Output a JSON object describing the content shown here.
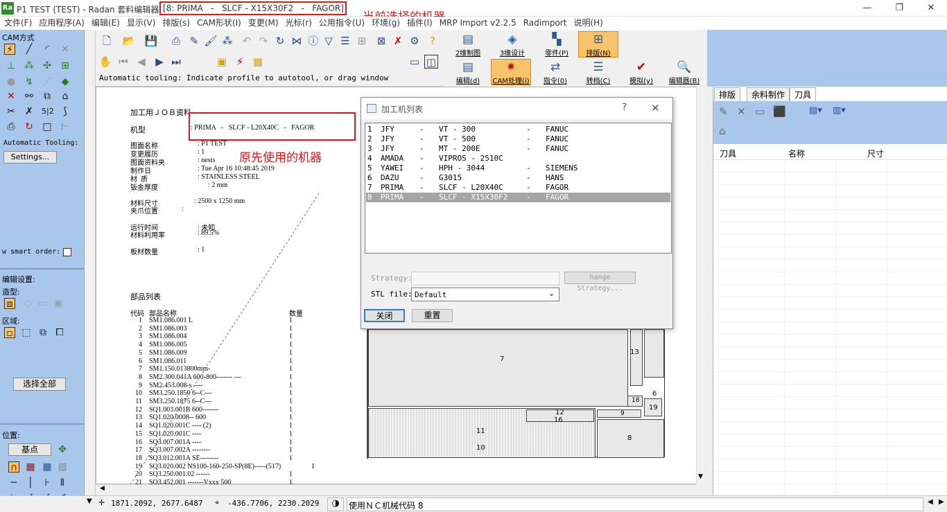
{
  "window": {
    "logo": "Ra",
    "title_prefix": "P1 TEST (TEST) - Radan 套料编辑器",
    "title_machine": "[8: PRIMA   -   SLCF - X15X30F2   -   FAGOR]",
    "annotation_current": "当前选择的机器",
    "annotation_original": "原先使用的机器",
    "controls": [
      "—",
      "❐",
      "✕"
    ]
  },
  "menu": [
    "文件(F)",
    "应用程序(A)",
    "编辑(E)",
    "显示(V)",
    "排版(s)",
    "CAM形状(I)",
    "变更(M)",
    "光标(r)",
    "公用指令(U)",
    "环境(g)",
    "插件(l)",
    "MRP Import v2.2.5",
    "Radimport",
    "说明(H)"
  ],
  "left_panel": {
    "cam_title": "CAM方式",
    "auto_tooling_label": "Automatic Tooling:",
    "settings_button": "Settings...",
    "smart_order_label": "w smart order:",
    "edit_settings": "编辑设置:",
    "shape_label": "造型:",
    "region_label": "区域:",
    "select_all": "选择全部",
    "position_label": "位置:",
    "base_point": "基点"
  },
  "big_buttons": [
    {
      "label": "2维制图",
      "icon": "drawing-2d-icon"
    },
    {
      "label": "3维设计",
      "icon": "design-3d-icon"
    },
    {
      "label": "零件(P)",
      "icon": "part-icon"
    },
    {
      "label": "排版(N)",
      "icon": "nest-icon",
      "active": true
    },
    {
      "label": "编辑(d)",
      "icon": "edit-icon"
    },
    {
      "label": "CAM处理(i)",
      "icon": "cam-icon",
      "active": true
    },
    {
      "label": "指令(0)",
      "icon": "command-icon"
    },
    {
      "label": "转档(C)",
      "icon": "convert-icon"
    },
    {
      "label": "模拟(y)",
      "icon": "simulate-icon"
    },
    {
      "label": "编辑器(B)",
      "icon": "editor-icon"
    }
  ],
  "auto_tooling_text": "Automatic tooling: Indicate profile to autotool, or drag window",
  "job": {
    "heading": "加工用ＪＯＢ资料",
    "machine_label": "机型",
    "machine_value": ": PRIMA   -   SLCF - L20X40C   -   FAGOR",
    "drawing_name_label": "图面名称",
    "drawing_name_value": ": P1 TEST",
    "revision_label": "变更履历",
    "revision_value": ": 1",
    "folder_label": "图面资料夹",
    "folder_value": ": nests",
    "date_label": "制作日",
    "date_value": ": Tue Apr 16 10:48:45 2019",
    "material_label": "材  质",
    "material_value": ": STAINLESS STEEL",
    "thickness_label": "钣金厚度",
    "thickness_value": ": 2 mm",
    "sheet_size_label": "材料尺寸",
    "sheet_size_value": ": 2500 x 1250 mm",
    "clamp_label": "夹爪位置",
    "clamp_value": ":",
    "run_time_label": "运行时间",
    "run_time_value": ": 未知",
    "utilization_label": "材料利用率",
    "utilization_value": ": 89.5%",
    "sheets_label": "板材数量",
    "sheets_value": ": 1",
    "parts_heading": "部品列表",
    "col_code": "代码",
    "col_name": "部品名称",
    "col_qty": "数量",
    "parts": [
      {
        "no": "1",
        "name": "SM1.086.001 L",
        "qty": "1"
      },
      {
        "no": "2",
        "name": "SM1.086.003",
        "qty": "1"
      },
      {
        "no": "3",
        "name": "SM1.086.004",
        "qty": "1"
      },
      {
        "no": "4",
        "name": "SM1.086.005",
        "qty": "1"
      },
      {
        "no": "5",
        "name": "SM1.086.009",
        "qty": "1"
      },
      {
        "no": "6",
        "name": "SM1.086.011",
        "qty": "1"
      },
      {
        "no": "7",
        "name": "SM1.150.013800mm-",
        "qty": "1"
      },
      {
        "no": "8",
        "name": "SM2.300.041A 600-800------- ---",
        "qty": "1"
      },
      {
        "no": "9",
        "name": "SM2.453.008-s ----",
        "qty": "1"
      },
      {
        "no": "10",
        "name": "SM3.250.1850 6--C---",
        "qty": "1"
      },
      {
        "no": "11",
        "name": "SM3.250.1875 6--C---",
        "qty": "1"
      },
      {
        "no": "12",
        "name": "SQ1.003.001B 600-------",
        "qty": "1"
      },
      {
        "no": "13",
        "name": "SQ1.020.0008-- 600",
        "qty": "1"
      },
      {
        "no": "14",
        "name": "SQ1.020.001C ---- (2)",
        "qty": "1"
      },
      {
        "no": "15",
        "name": "SQ1.020.001C ----",
        "qty": "1"
      },
      {
        "no": "16",
        "name": "SQ3.007.001A ----",
        "qty": "1"
      },
      {
        "no": "17",
        "name": "SQ3.007.002A --------",
        "qty": "1"
      },
      {
        "no": "18",
        "name": "SQ3.012.001A SE--------",
        "qty": "1"
      },
      {
        "no": "19",
        "name": "SQ3.020.002 NS100-160-250-SP(8E)-----(517)",
        "qty": "1"
      },
      {
        "no": "20",
        "name": "SQ3.250.001.02 ------",
        "qty": "1"
      },
      {
        "no": "21",
        "name": "SQ3.452.001 -------Vxxx 500",
        "qty": "1"
      }
    ]
  },
  "sheet_labels": [
    "13",
    "7",
    "6",
    "18",
    "19",
    "12",
    "16",
    "9",
    "11",
    "10",
    "8"
  ],
  "dialog": {
    "title": "加工机列表",
    "help": "?",
    "close": "✕",
    "machines": [
      {
        "no": "1",
        "maker": "JFY",
        "model": "VT - 300",
        "control": "FANUC"
      },
      {
        "no": "2",
        "maker": "JFY",
        "model": "VT - 500",
        "control": "FANUC"
      },
      {
        "no": "3",
        "maker": "JFY",
        "model": "MT - 200E",
        "control": "FANUC"
      },
      {
        "no": "4",
        "maker": "AMADA",
        "model": "VIPROS - 2510C",
        "control": ""
      },
      {
        "no": "5",
        "maker": "YAWEI",
        "model": "HPH - 3044",
        "control": "SIEMENS"
      },
      {
        "no": "6",
        "maker": "DAZU",
        "model": "G3015",
        "control": "HANS"
      },
      {
        "no": "7",
        "maker": "PRIMA",
        "model": "SLCF - L20X40C",
        "control": "FAGOR"
      },
      {
        "no": "8",
        "maker": "PRIMA",
        "model": "SLCF - X15X30F2",
        "control": "FAGOR",
        "selected": true
      }
    ],
    "strategy_label": "Strategy:",
    "strategy_button": "hange Strategy...",
    "stl_label": "STL file:",
    "stl_value": "Default",
    "close_button": "关闭",
    "reset_button": "重置"
  },
  "right_panel": {
    "tabs": [
      "排版",
      "余料制作",
      "刀具"
    ],
    "active_tab": "刀具",
    "columns": [
      "刀具",
      "名称",
      "尺寸"
    ]
  },
  "status": {
    "coord1": "1871.2092,  2677.6487",
    "coord2": "-436.7706,  2230.2029",
    "nc_text": "使用ＮＣ机械代码 8"
  },
  "colors": {
    "left_panel": "#a8c7ea",
    "annotation": "#e01818",
    "active_button": "#f7c46c"
  }
}
